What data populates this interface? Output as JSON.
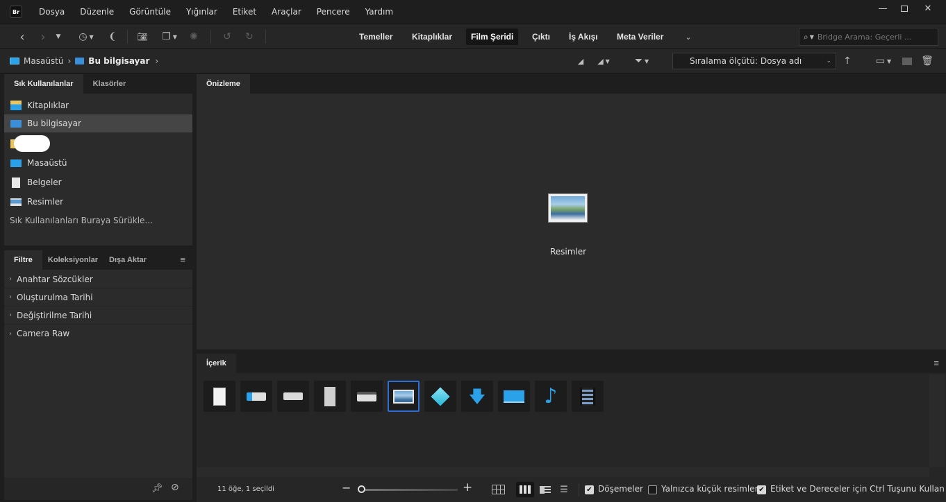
{
  "app": {
    "logo_text": "Br"
  },
  "menu": [
    "Dosya",
    "Düzenle",
    "Görüntüle",
    "Yığınlar",
    "Etiket",
    "Araçlar",
    "Pencere",
    "Yardım"
  ],
  "workspaces": [
    "Temeller",
    "Kitaplıklar",
    "Film Şeridi",
    "Çıktı",
    "İş Akışı",
    "Meta Veriler"
  ],
  "active_workspace": "Film Şeridi",
  "search": {
    "placeholder": "Bridge Arama: Geçerli ..."
  },
  "breadcrumb": [
    "Masaüstü",
    "Bu bilgisayar"
  ],
  "sort": {
    "label": "Sıralama ölçütü: Dosya adı"
  },
  "favorites_panel": {
    "tabs": [
      "Sık Kullanılanlar",
      "Klasörler"
    ],
    "items": [
      "Kitaplıklar",
      "Bu bilgisayar",
      "",
      "Masaüstü",
      "Belgeler",
      "Resimler"
    ],
    "selected_index": 1,
    "drop_hint": "Sık Kullanılanları Buraya Sürükle..."
  },
  "filter_panel": {
    "tabs": [
      "Filtre",
      "Koleksiyonlar",
      "Dışa Aktar"
    ],
    "items": [
      "Anahtar Sözcükler",
      "Oluşturulma Tarihi",
      "Değiştirilme Tarihi",
      "Camera Raw"
    ]
  },
  "preview": {
    "tab": "Önizleme",
    "caption": "Resimler"
  },
  "content": {
    "tab": "İçerik",
    "tiles": [
      "documents-icon",
      "windows-drive-icon",
      "drive-icon",
      "tower-icon",
      "dvd-drive-icon",
      "pictures-folder-icon",
      "3d-objects-icon",
      "downloads-icon",
      "desktop-icon",
      "music-icon",
      "videos-icon"
    ],
    "selected_index": 5
  },
  "status": {
    "count": "11 öğe, 1 seçildi",
    "tiles_label": "Döşemeler",
    "tiles_checked": true,
    "thumbs_only_label": "Yalnızca küçük resimler",
    "thumbs_only_checked": false,
    "ctrl_label": "Etiket ve Dereceler için Ctrl Tuşunu Kullan",
    "ctrl_checked": true
  },
  "colors": {
    "accent": "#2d6fd4",
    "folder_blue": "#2aa1e8"
  }
}
